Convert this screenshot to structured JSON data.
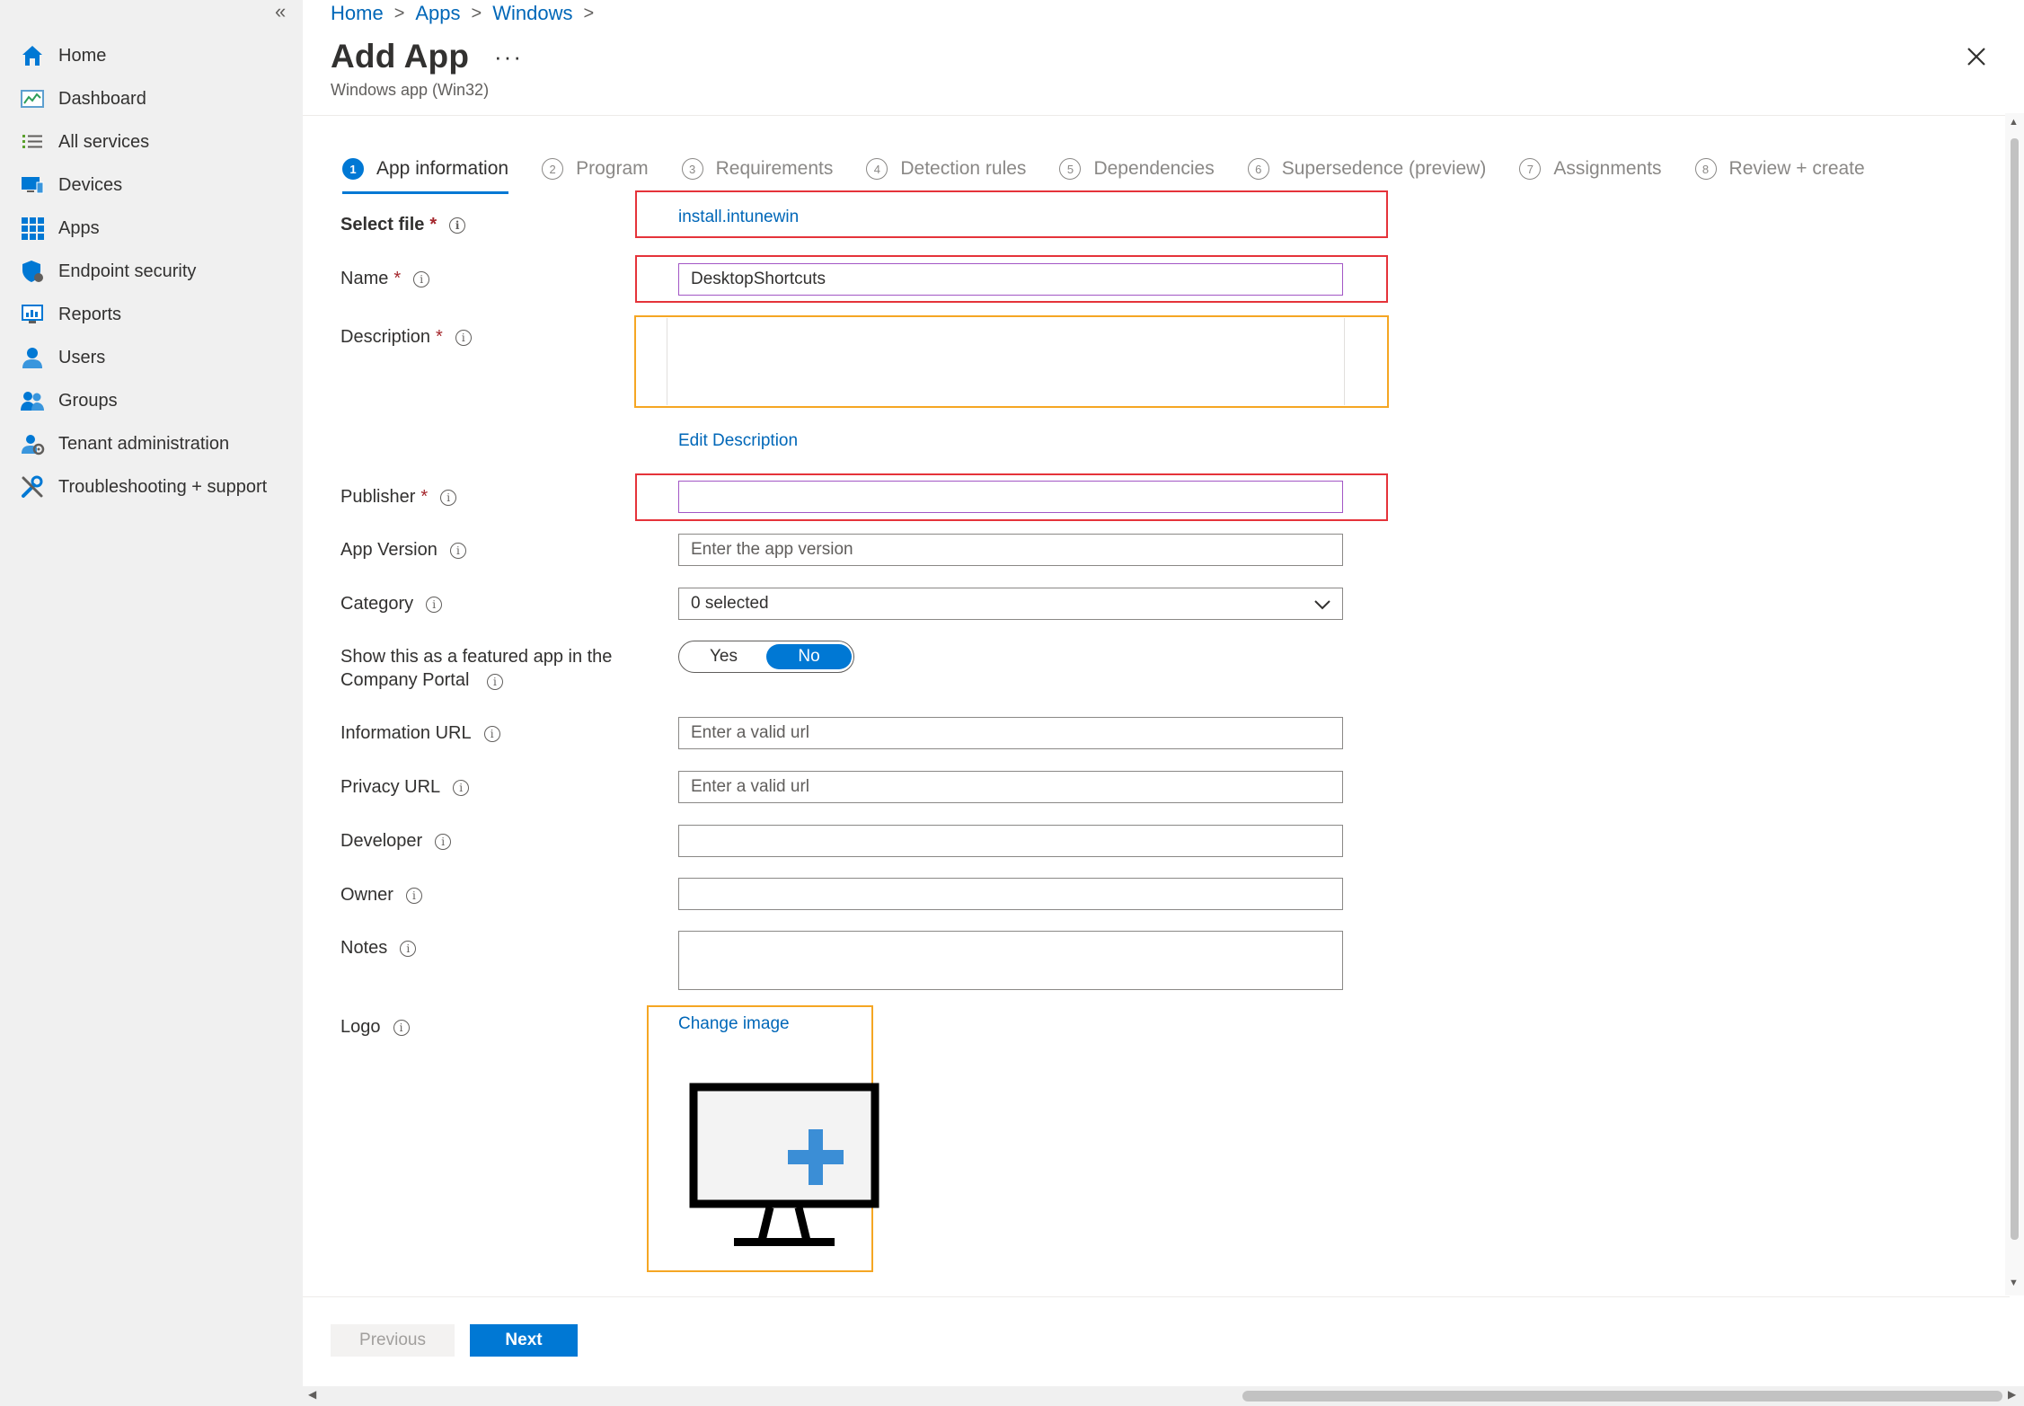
{
  "sidebar": {
    "collapse_glyph": "«",
    "items": [
      {
        "label": "Home",
        "icon": "home-icon"
      },
      {
        "label": "Dashboard",
        "icon": "dashboard-icon"
      },
      {
        "label": "All services",
        "icon": "list-icon"
      },
      {
        "label": "Devices",
        "icon": "devices-icon"
      },
      {
        "label": "Apps",
        "icon": "apps-grid-icon"
      },
      {
        "label": "Endpoint security",
        "icon": "shield-icon"
      },
      {
        "label": "Reports",
        "icon": "reports-icon"
      },
      {
        "label": "Users",
        "icon": "user-icon"
      },
      {
        "label": "Groups",
        "icon": "groups-icon"
      },
      {
        "label": "Tenant administration",
        "icon": "tenant-gear-icon"
      },
      {
        "label": "Troubleshooting + support",
        "icon": "tools-icon"
      }
    ]
  },
  "breadcrumb": [
    "Home",
    "Apps",
    "Windows"
  ],
  "header": {
    "title": "Add App",
    "subtitle": "Windows app (Win32)",
    "more": "···"
  },
  "tabs": [
    {
      "num": "1",
      "label": "App information",
      "active": true
    },
    {
      "num": "2",
      "label": "Program"
    },
    {
      "num": "3",
      "label": "Requirements"
    },
    {
      "num": "4",
      "label": "Detection rules"
    },
    {
      "num": "5",
      "label": "Dependencies"
    },
    {
      "num": "6",
      "label": "Supersedence (preview)"
    },
    {
      "num": "7",
      "label": "Assignments"
    },
    {
      "num": "8",
      "label": "Review + create"
    }
  ],
  "form": {
    "required_mark": "*",
    "info_glyph": "i",
    "select_file": {
      "label": "Select file",
      "value": "install.intunewin"
    },
    "name": {
      "label": "Name",
      "value": "DesktopShortcuts"
    },
    "description": {
      "label": "Description",
      "edit_link": "Edit Description"
    },
    "publisher": {
      "label": "Publisher",
      "value": ""
    },
    "app_version": {
      "label": "App Version",
      "placeholder": "Enter the app version"
    },
    "category": {
      "label": "Category",
      "value": "0 selected"
    },
    "featured": {
      "label": "Show this as a featured app in the Company Portal",
      "yes": "Yes",
      "no": "No",
      "selected": "No"
    },
    "information_url": {
      "label": "Information URL",
      "placeholder": "Enter a valid url"
    },
    "privacy_url": {
      "label": "Privacy URL",
      "placeholder": "Enter a valid url"
    },
    "developer": {
      "label": "Developer",
      "value": ""
    },
    "owner": {
      "label": "Owner",
      "value": ""
    },
    "notes": {
      "label": "Notes",
      "value": ""
    },
    "logo": {
      "label": "Logo",
      "change_link": "Change image",
      "icon": "monitor-plus-icon"
    }
  },
  "footer": {
    "previous": "Previous",
    "next": "Next"
  },
  "colors": {
    "accent": "#0078d4",
    "link": "#0067b8",
    "highlight_red": "#e5333a",
    "highlight_orange": "#f5a623"
  }
}
